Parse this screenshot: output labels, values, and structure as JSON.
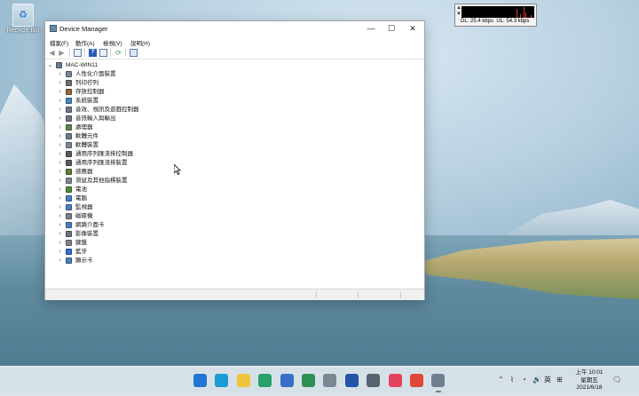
{
  "desktop": {
    "icons": [
      {
        "label": "Recycle Bin",
        "icon": "recycle-bin-icon"
      }
    ]
  },
  "net_meter": {
    "side_labels": [
      "▲",
      "▼"
    ],
    "dl": "DL: 25.4 kbps",
    "ul": "UL: 54.3 kbps"
  },
  "window": {
    "title": "Device Manager",
    "controls": {
      "minimize": "—",
      "maximize": "☐",
      "close": "✕"
    },
    "menu": [
      "檔案(F)",
      "動作(A)",
      "檢視(V)",
      "說明(H)"
    ],
    "toolbar_icons": [
      "back-icon",
      "forward-icon",
      "properties-icon",
      "help-icon",
      "show-hidden-icon",
      "update-driver-icon",
      "scan-hardware-icon"
    ],
    "tree": {
      "root": {
        "label": "MAC-WIN11",
        "icon": "computer-icon"
      },
      "items": [
        {
          "label": "人性化介面裝置",
          "icon": "hid-icon",
          "color": "#7a8797"
        },
        {
          "label": "列印佇列",
          "icon": "printer-icon",
          "color": "#6b6f75"
        },
        {
          "label": "存放控制器",
          "icon": "storage-controller-icon",
          "color": "#8c6c3c"
        },
        {
          "label": "系統裝置",
          "icon": "system-device-icon",
          "color": "#4a83c4"
        },
        {
          "label": "音效、視訊及遊戲控制器",
          "icon": "speaker-icon",
          "color": "#6d7886"
        },
        {
          "label": "音訊輸入與輸出",
          "icon": "audio-io-icon",
          "color": "#6d7886"
        },
        {
          "label": "處理器",
          "icon": "processor-icon",
          "color": "#5b8a4b"
        },
        {
          "label": "軟體元件",
          "icon": "software-component-icon",
          "color": "#6f7c8a"
        },
        {
          "label": "軟體裝置",
          "icon": "software-device-icon",
          "color": "#7c8794"
        },
        {
          "label": "通用序列匯流排控制器",
          "icon": "usb-controller-icon",
          "color": "#555b63"
        },
        {
          "label": "通用序列匯流排裝置",
          "icon": "usb-device-icon",
          "color": "#555b63"
        },
        {
          "label": "感應器",
          "icon": "sensor-icon",
          "color": "#5f7f3c"
        },
        {
          "label": "滑鼠及其他指標裝置",
          "icon": "mouse-icon",
          "color": "#7e8894"
        },
        {
          "label": "電池",
          "icon": "battery-icon",
          "color": "#4f8b3b"
        },
        {
          "label": "電腦",
          "icon": "computer-icon",
          "color": "#4a7fc0"
        },
        {
          "label": "監視器",
          "icon": "monitor-icon",
          "color": "#4a7fc0"
        },
        {
          "label": "磁碟機",
          "icon": "disk-drive-icon",
          "color": "#7c8088"
        },
        {
          "label": "網路介面卡",
          "icon": "network-adapter-icon",
          "color": "#4a7fc0"
        },
        {
          "label": "影像裝置",
          "icon": "camera-icon",
          "color": "#6b7480"
        },
        {
          "label": "鍵盤",
          "icon": "keyboard-icon",
          "color": "#80868f"
        },
        {
          "label": "藍牙",
          "icon": "bluetooth-icon",
          "color": "#2f6fd0"
        },
        {
          "label": "顯示卡",
          "icon": "display-adapter-icon",
          "color": "#4a7fc0"
        }
      ]
    }
  },
  "taskbar": {
    "apps": [
      {
        "name": "start-icon",
        "color": "#1f76d3"
      },
      {
        "name": "edge-icon",
        "color": "#1c9ad6"
      },
      {
        "name": "file-explorer-icon",
        "color": "#f2c43c"
      },
      {
        "name": "settings-gear-icon",
        "color": "#2aa06a"
      },
      {
        "name": "network-app-icon",
        "color": "#3a6ec9"
      },
      {
        "name": "task-app-icon",
        "color": "#2e8f52"
      },
      {
        "name": "package-icon",
        "color": "#7b8794"
      },
      {
        "name": "app-icon",
        "color": "#2456a8"
      },
      {
        "name": "gear-icon",
        "color": "#556270"
      },
      {
        "name": "music-icon",
        "color": "#e3425e"
      },
      {
        "name": "chrome-icon",
        "color": "#e0463a"
      },
      {
        "name": "device-manager-icon",
        "color": "#6e7f90"
      }
    ],
    "tray": {
      "chevron": "⌃",
      "ime": "英",
      "ime_icon": "⊞"
    },
    "clock": {
      "time": "上午 10:01",
      "weekday": "星期五",
      "date": "2021/6/18"
    }
  }
}
